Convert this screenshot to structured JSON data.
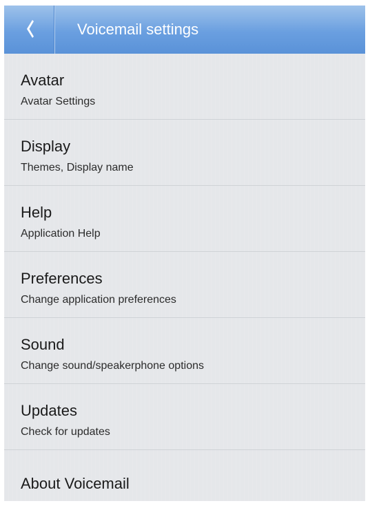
{
  "action_bar": {
    "title": "Voicemail settings",
    "back_icon": "chevron-left-icon",
    "background_color": "#6a9fe0"
  },
  "settings": [
    {
      "title": "Avatar",
      "subtitle": "Avatar Settings"
    },
    {
      "title": "Display",
      "subtitle": "Themes, Display name"
    },
    {
      "title": "Help",
      "subtitle": "Application Help"
    },
    {
      "title": "Preferences",
      "subtitle": "Change application preferences"
    },
    {
      "title": "Sound",
      "subtitle": "Change sound/speakerphone options"
    },
    {
      "title": "Updates",
      "subtitle": "Check for updates"
    },
    {
      "title": "About Voicemail"
    }
  ]
}
